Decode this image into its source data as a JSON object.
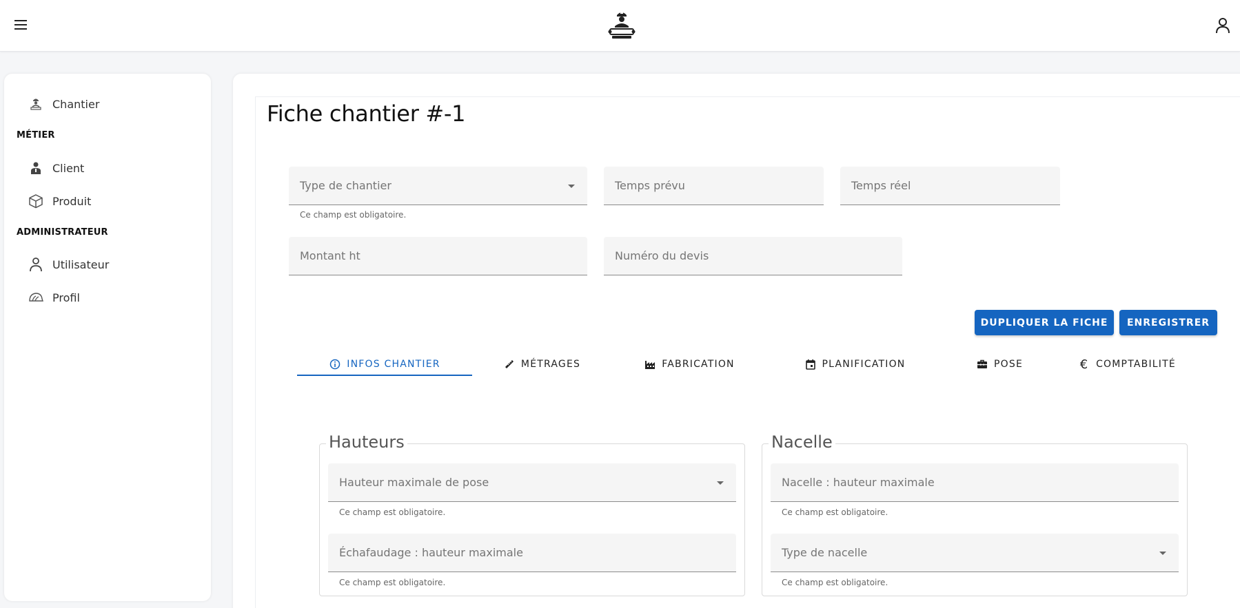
{
  "sidebar": {
    "items": [
      {
        "label": "Chantier",
        "icon": "worker-icon"
      },
      {
        "label": "Client",
        "icon": "client-icon"
      },
      {
        "label": "Produit",
        "icon": "box-icon"
      },
      {
        "label": "Utilisateur",
        "icon": "user-icon"
      },
      {
        "label": "Profil",
        "icon": "profile-hat-icon"
      }
    ],
    "sections": {
      "metier": "MÉTIER",
      "admin": "ADMINISTRATEUR"
    }
  },
  "main": {
    "title": "Fiche chantier #-1",
    "fields": {
      "type_chantier": "Type de chantier",
      "temps_prevu": "Temps prévu",
      "temps_reel": "Temps réel",
      "montant_ht": "Montant ht",
      "numero_devis": "Numéro du devis"
    },
    "helper": "Ce champ est obligatoire.",
    "buttons": {
      "dupliquer": "DUPLIQUER LA FICHE",
      "enregistrer": "ENREGISTRER"
    },
    "tabs": [
      {
        "label": "INFOS CHANTIER",
        "icon": "info-icon",
        "active": true
      },
      {
        "label": "MÉTRAGES",
        "icon": "ruler-icon"
      },
      {
        "label": "FABRICATION",
        "icon": "factory-icon"
      },
      {
        "label": "PLANIFICATION",
        "icon": "calendar-icon"
      },
      {
        "label": "POSE",
        "icon": "toolbox-icon"
      },
      {
        "label": "COMPTABILITÉ",
        "icon": "euro-icon"
      }
    ],
    "hauteurs": {
      "legend": "Hauteurs",
      "hauteur_max_pose": "Hauteur maximale de pose",
      "echafaudage": "Échafaudage : hauteur maximale"
    },
    "nacelle": {
      "legend": "Nacelle",
      "hauteur_max": "Nacelle : hauteur maximale",
      "type": "Type de nacelle"
    }
  },
  "colors": {
    "accent": "#1565c0",
    "background": "#f5f6f8",
    "field_bg": "#f5f5f5"
  }
}
